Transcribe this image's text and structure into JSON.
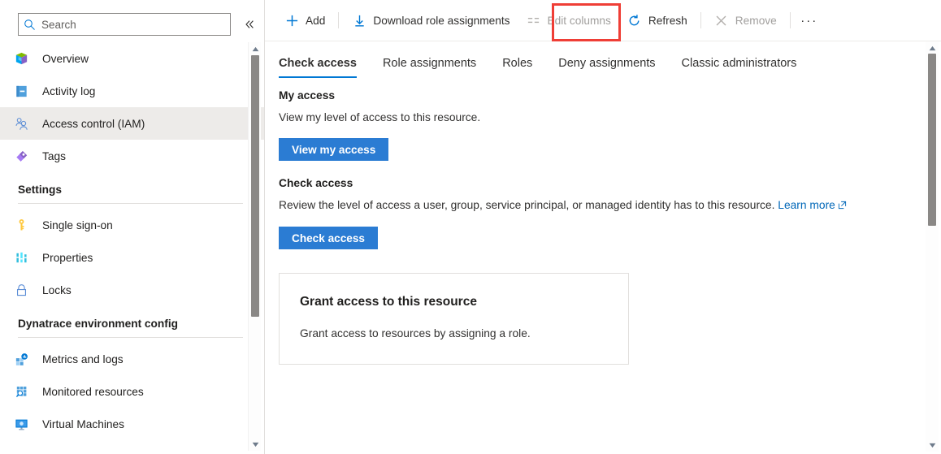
{
  "sidebar": {
    "search": {
      "placeholder": "Search",
      "value": "",
      "icon": "search-icon"
    },
    "collapse_icon": "chevron-double-left-icon",
    "items": [
      {
        "label": "Overview",
        "icon": "cube-icon",
        "selected": false
      },
      {
        "label": "Activity log",
        "icon": "activity-log-icon",
        "selected": false
      },
      {
        "label": "Access control (IAM)",
        "icon": "access-control-icon",
        "selected": true
      },
      {
        "label": "Tags",
        "icon": "tag-icon",
        "selected": false
      }
    ],
    "groups": [
      {
        "title": "Settings",
        "items": [
          {
            "label": "Single sign-on",
            "icon": "key-icon"
          },
          {
            "label": "Properties",
            "icon": "properties-icon"
          },
          {
            "label": "Locks",
            "icon": "lock-icon"
          }
        ]
      },
      {
        "title": "Dynatrace environment config",
        "items": [
          {
            "label": "Metrics and logs",
            "icon": "metrics-logs-icon"
          },
          {
            "label": "Monitored resources",
            "icon": "monitored-resources-icon"
          },
          {
            "label": "Virtual Machines",
            "icon": "virtual-machines-icon"
          }
        ]
      }
    ]
  },
  "toolbar": {
    "add_label": "Add",
    "download_label": "Download role assignments",
    "edit_columns_label": "Edit columns",
    "refresh_label": "Refresh",
    "remove_label": "Remove",
    "more_label": "···",
    "highlight_color": "#ef3e36"
  },
  "tabs": [
    {
      "label": "Check access",
      "active": true
    },
    {
      "label": "Role assignments",
      "active": false
    },
    {
      "label": "Roles",
      "active": false
    },
    {
      "label": "Deny assignments",
      "active": false
    },
    {
      "label": "Classic administrators",
      "active": false
    }
  ],
  "main": {
    "my_access": {
      "title": "My access",
      "description": "View my level of access to this resource.",
      "button": "View my access"
    },
    "check_access": {
      "title": "Check access",
      "description": "Review the level of access a user, group, service principal, or managed identity has to this resource. ",
      "link": "Learn more",
      "button": "Check access"
    },
    "grant_card": {
      "title": "Grant access to this resource",
      "description": "Grant access to resources by assigning a role."
    }
  },
  "colors": {
    "accent": "#0078d4",
    "button": "#2b7cd3",
    "link": "#0067b8",
    "selected_bg": "#edebe9"
  }
}
